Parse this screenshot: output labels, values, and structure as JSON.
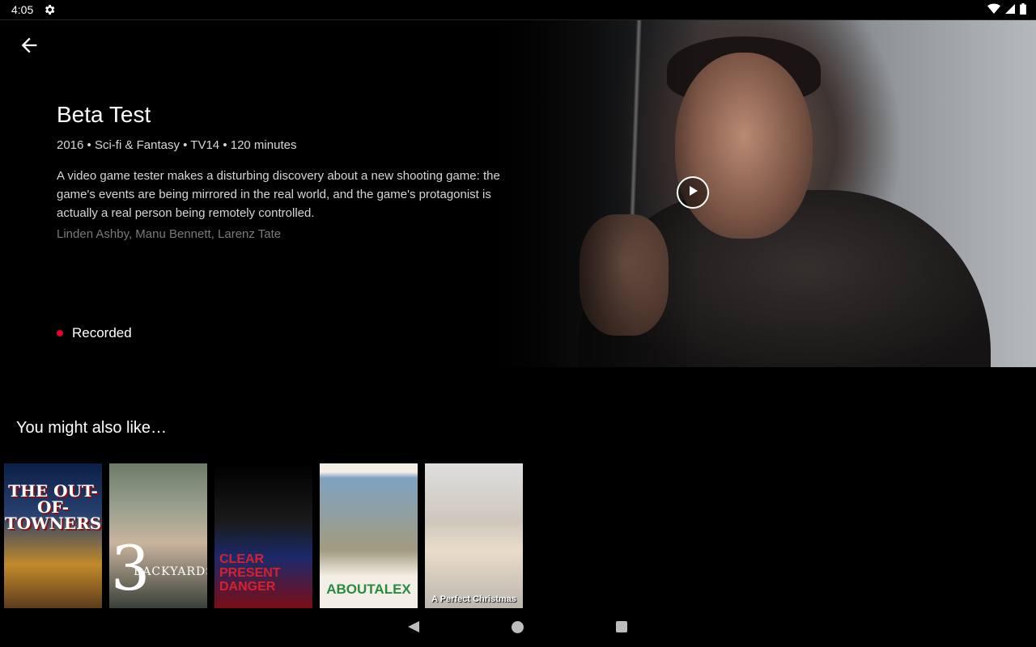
{
  "status_bar": {
    "time": "4:05"
  },
  "program": {
    "title": "Beta Test",
    "meta": "2016 • Sci-fi & Fantasy • TV14 • 120 minutes",
    "description": "A video game tester makes a disturbing discovery about a new shooting game: the game's events are being mirrored in the real world, and the game's protagonist is actually a real person being remotely controlled.",
    "cast": "Linden Ashby, Manu Bennett, Larenz Tate",
    "status": "Recorded",
    "status_color": "#e4002b"
  },
  "recommendations": {
    "heading": "You might also like…",
    "posters": [
      {
        "title_art": "THE OUT-OF-TOWNERS"
      },
      {
        "title_art_number": "3",
        "title_art": "BACKYARDS"
      },
      {
        "title_art": "CLEAR PRESENT DANGER"
      },
      {
        "title_art": "ABOUTALEX"
      },
      {
        "title_art": "A Perfect Christmas"
      }
    ]
  },
  "icons": {
    "back": "arrow-left-icon",
    "settings": "gear-icon",
    "play": "play-icon",
    "wifi": "wifi-icon",
    "signal": "signal-icon",
    "battery": "battery-icon"
  }
}
